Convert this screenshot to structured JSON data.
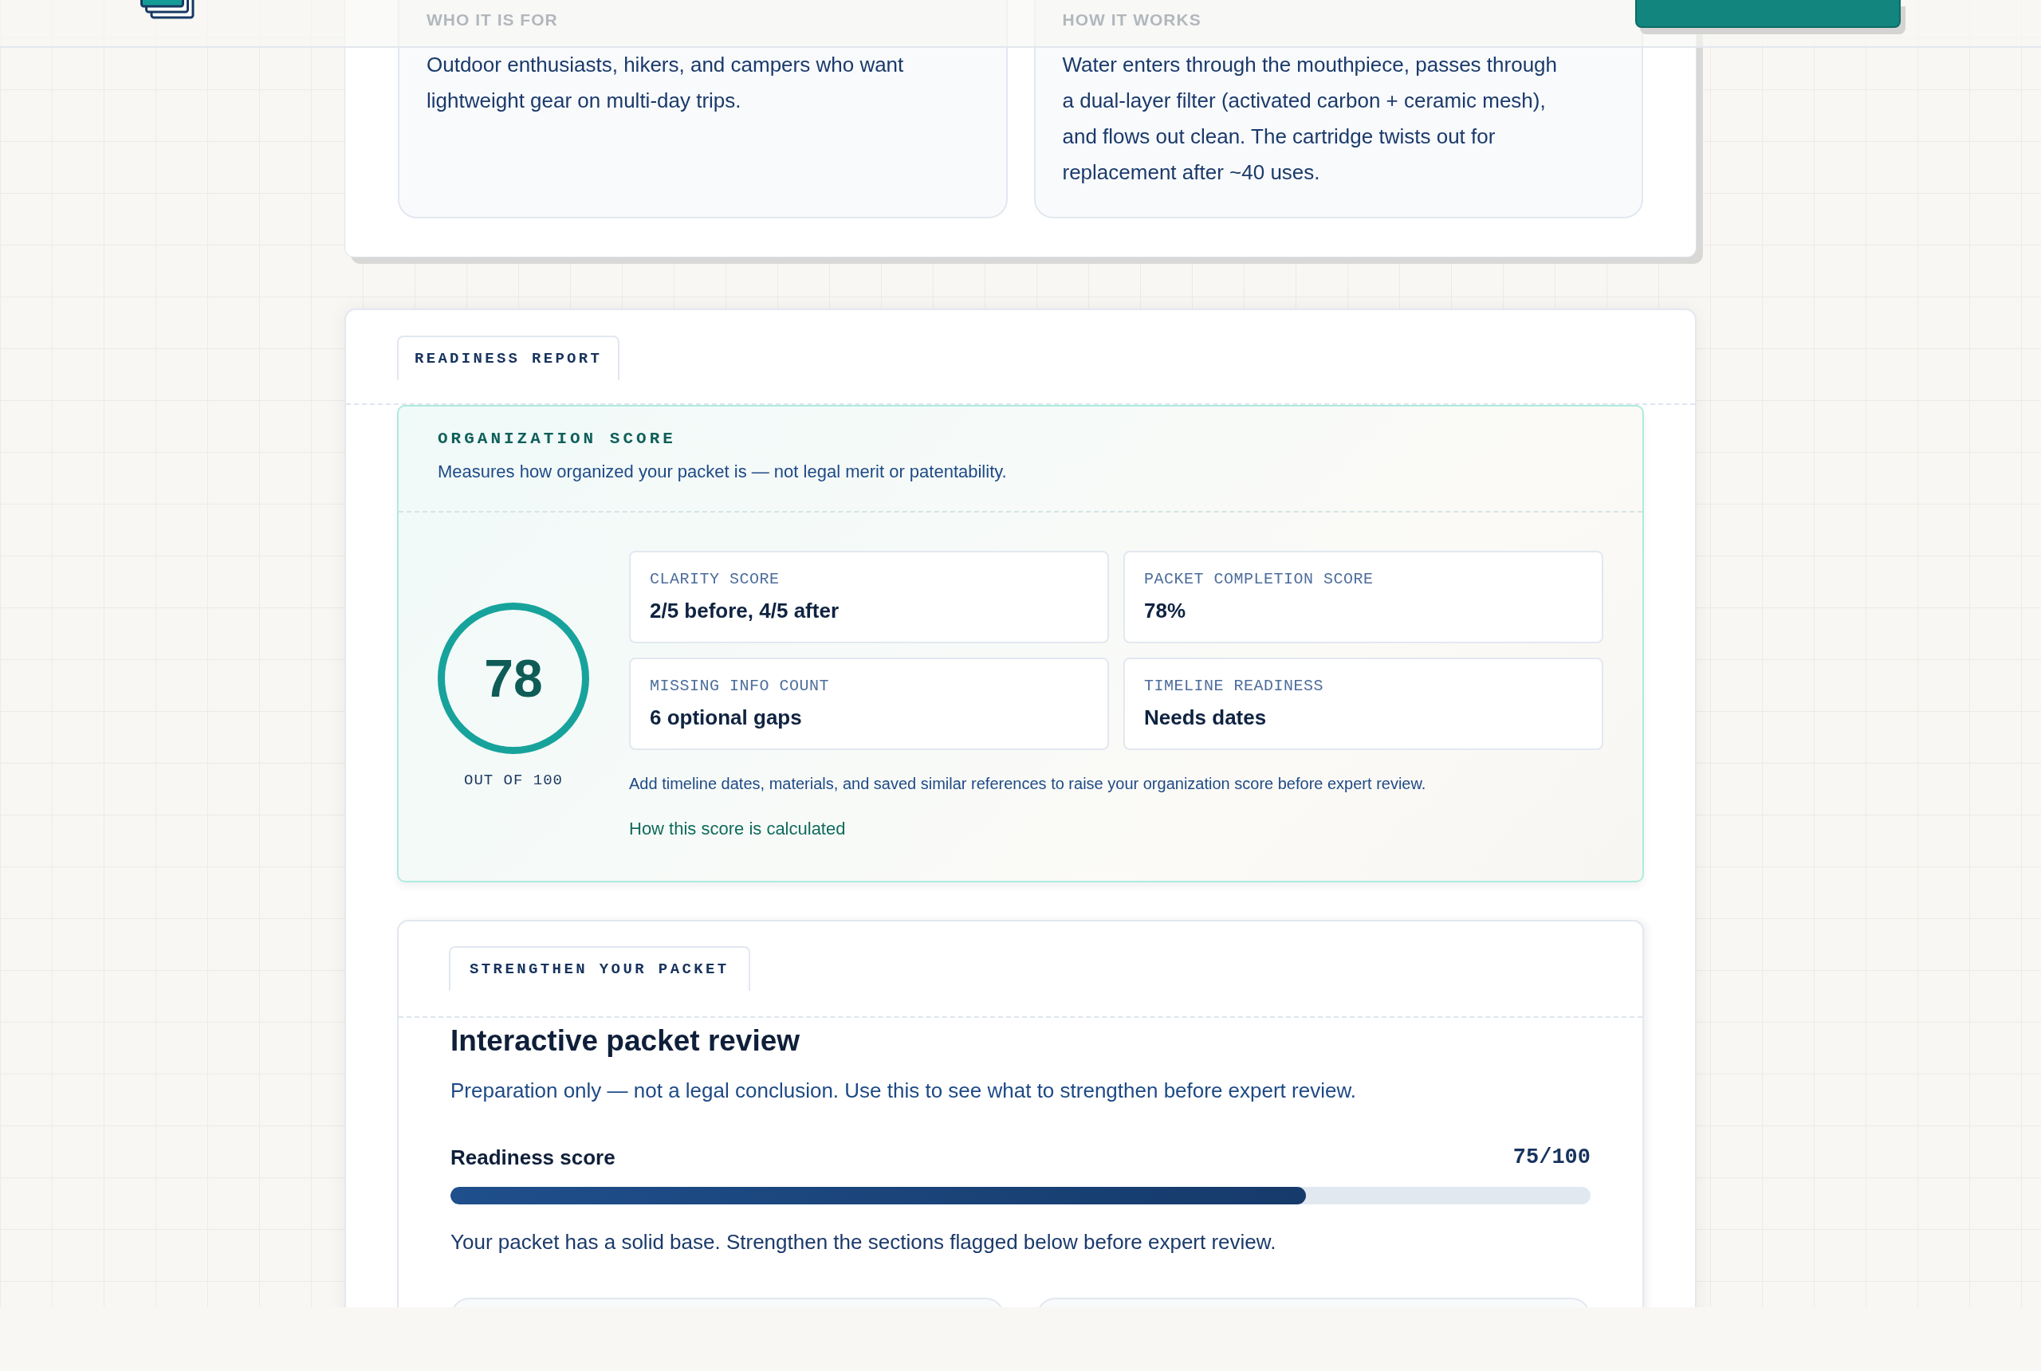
{
  "overview": {
    "cards": [
      {
        "label": "WHO IT IS FOR",
        "text": "Outdoor enthusiasts, hikers, and campers who want lightweight gear on multi-day trips."
      },
      {
        "label": "HOW IT WORKS",
        "text": "Water enters through the mouthpiece, passes through a dual-layer filter (activated carbon + ceramic mesh), and flows out clean. The cartridge twists out for replacement after ~40 uses."
      }
    ]
  },
  "readiness_report": {
    "tab": "READINESS REPORT",
    "organization_score": {
      "title": "ORGANIZATION SCORE",
      "subtitle": "Measures how organized your packet is — not legal merit or patentability.",
      "score": "78",
      "score_caption": "OUT OF 100",
      "metrics": [
        {
          "label": "CLARITY SCORE",
          "value": "2/5 before, 4/5 after"
        },
        {
          "label": "PACKET COMPLETION SCORE",
          "value": "78%"
        },
        {
          "label": "MISSING INFO COUNT",
          "value": "6 optional gaps"
        },
        {
          "label": "TIMELINE READINESS",
          "value": "Needs dates"
        }
      ],
      "note": "Add timeline dates, materials, and saved similar references to raise your organization score before expert review.",
      "link": "How this score is calculated"
    }
  },
  "strengthen": {
    "tab": "STRENGTHEN YOUR PACKET",
    "title": "Interactive packet review",
    "subtitle": "Preparation only — not a legal conclusion. Use this to see what to strengthen before expert review.",
    "readiness": {
      "label": "Readiness score",
      "reading": "75/100",
      "level": 0.75
    },
    "summary": "Your packet has a solid base. Strengthen the sections flagged below before expert review."
  }
}
